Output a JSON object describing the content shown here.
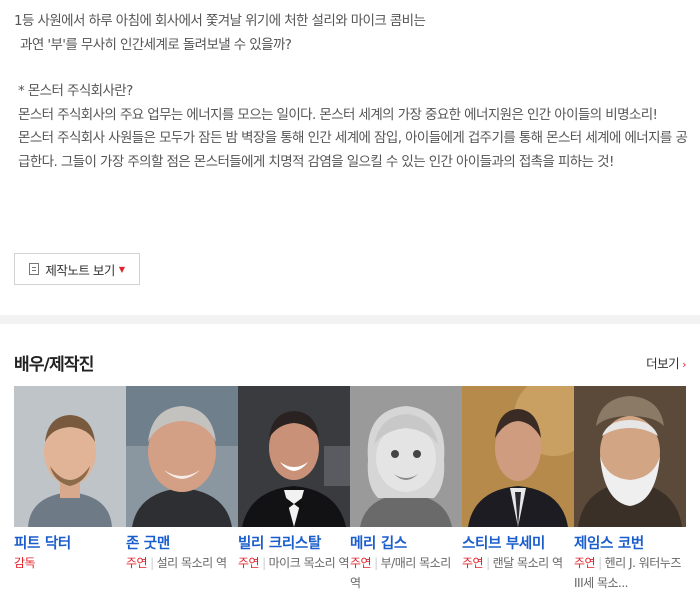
{
  "synopsis": {
    "line1": "1등 사원에서 하루 아침에 회사에서 쫓겨날 위기에 처한 설리와 마이크 콤비는",
    "line2": "과연 '부'를 무사히 인간세계로 돌려보낼 수 있을까?",
    "line3": "* 몬스터 주식회사란?",
    "line4": "몬스터 주식회사의 주요 업무는 에너지를 모으는 일이다. 몬스터 세계의 가장 중요한 에너지원은 인간 아이들의 비명소리!",
    "line5": "몬스터 주식회사 사원들은 모두가 잠든 밤 벽장을 통해 인간 세계에 잠입, 아이들에게 겁주기를 통해 몬스터 세계에 에너지를 공급한다. 그들이 가장 주의할 점은 몬스터들에게 치명적 감염을 일으킬 수 있는 인간 아이들과의 접촉을 피하는 것!"
  },
  "production_note_button": "제작노트 보기",
  "cast_section": {
    "title": "배우/제작진",
    "more": "더보기",
    "members": [
      {
        "name": "피트 닥터",
        "role_type": "감독",
        "role_desc": ""
      },
      {
        "name": "존 굿맨",
        "role_type": "주연",
        "role_desc": "설리 목소리 역"
      },
      {
        "name": "빌리 크리스탈",
        "role_type": "주연",
        "role_desc": "마이크 목소리 역"
      },
      {
        "name": "메리 깁스",
        "role_type": "주연",
        "role_desc": "부/매리 목소리 역"
      },
      {
        "name": "스티브 부세미",
        "role_type": "주연",
        "role_desc": "랜달 목소리 역"
      },
      {
        "name": "제임스 코번",
        "role_type": "주연",
        "role_desc": "헨리 J. 워터누즈 III세 목소..."
      }
    ]
  },
  "colors": {
    "accent_red": "#e0242d",
    "link_blue": "#1a5dcc"
  }
}
